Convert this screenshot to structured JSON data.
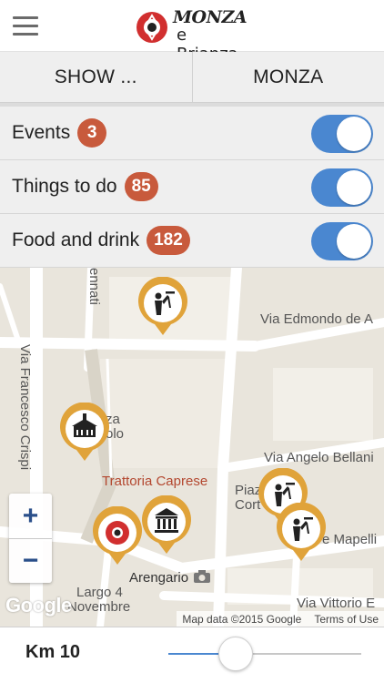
{
  "header": {
    "logo_line1": "MONZA",
    "logo_line2": "e Brianza",
    "icons": [
      "menu-icon",
      "monza-logo-mark"
    ]
  },
  "location_selector": {
    "left_label": "SHOW ...",
    "right_label": "MONZA"
  },
  "categories": [
    {
      "label": "Events",
      "count": "3",
      "enabled": true
    },
    {
      "label": "Things to do",
      "count": "85",
      "enabled": true
    },
    {
      "label": "Food and drink",
      "count": "182",
      "enabled": true
    }
  ],
  "map": {
    "streets": {
      "s1": "Via Edmondo de A",
      "s2": "Via Francesco Crispi",
      "s3": "Via Angelo Bellani",
      "s4": "e Mapelli",
      "s5": "Via Vittorio E",
      "s6": "Largo 4",
      "s7": "Novembre",
      "s8": "Piaz",
      "s9": "Cort",
      "s10": "ennati",
      "s11": "za",
      "s12": "olo"
    },
    "places": {
      "trattoria": "Trattoria Caprese",
      "arengario": "Arengario"
    },
    "pins": [
      {
        "category": "food-drink",
        "icon": "waiter-icon"
      },
      {
        "category": "things-to-do",
        "icon": "church-icon"
      },
      {
        "category": "events",
        "icon": "monza-logo-icon"
      },
      {
        "category": "things-to-do",
        "icon": "museum-icon"
      },
      {
        "category": "food-drink",
        "icon": "waiter-icon"
      },
      {
        "category": "food-drink",
        "icon": "waiter-icon"
      }
    ],
    "zoom_in": "+",
    "zoom_out": "−",
    "google_label": "Google",
    "attribution_data": "Map data ©2015 Google",
    "attribution_terms": "Terms of Use"
  },
  "distance": {
    "label": "Km 10",
    "slider_fraction": 0.35
  },
  "colors": {
    "accent_blue": "#4a87d0",
    "badge_red": "#c85a3c",
    "pin_gold": "#e0a33a",
    "logo_red": "#d12f2f"
  }
}
